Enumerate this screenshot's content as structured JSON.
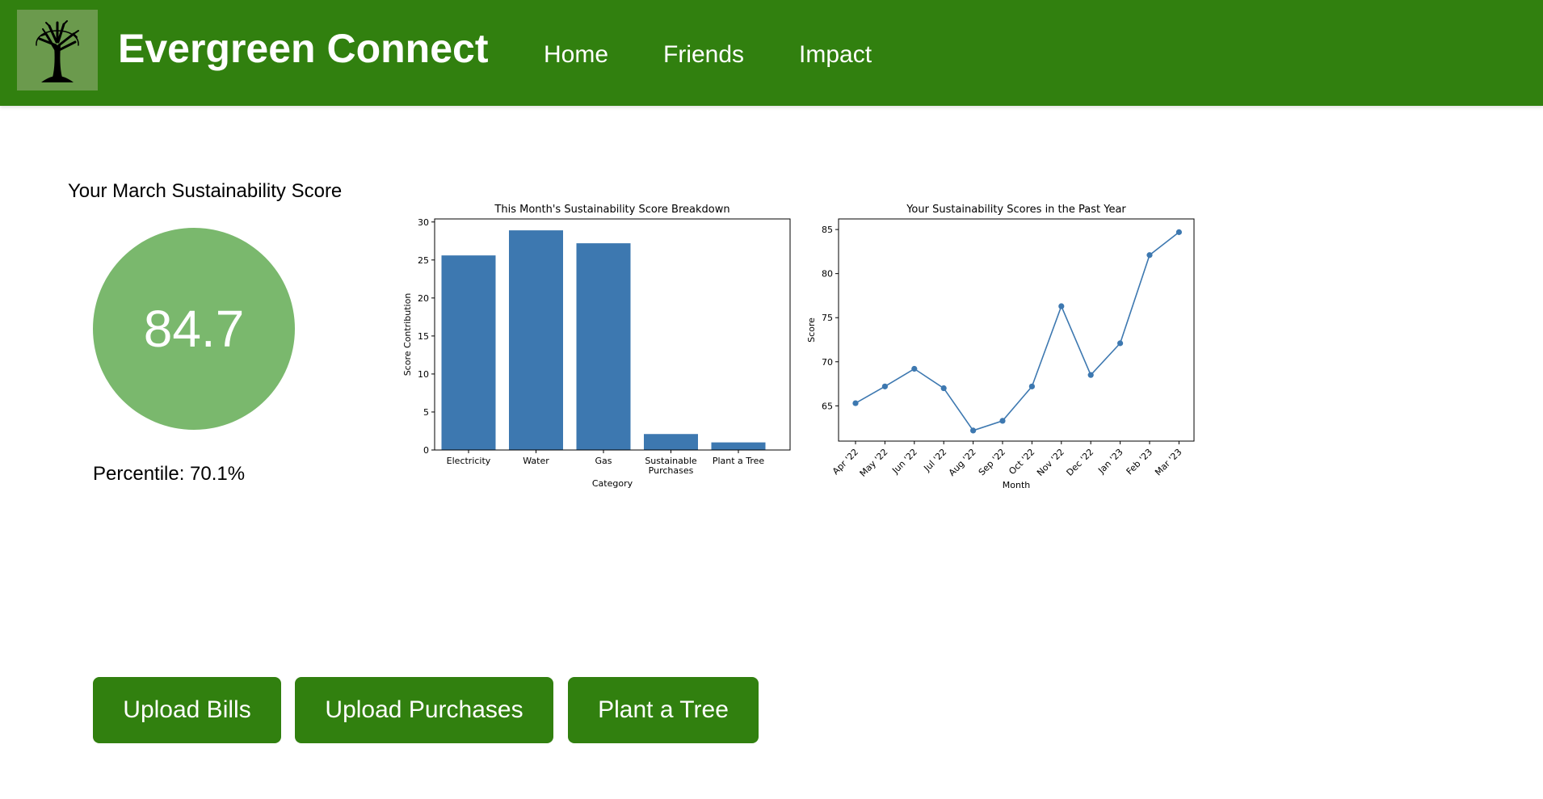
{
  "header": {
    "app_title": "Evergreen Connect",
    "nav": [
      "Home",
      "Friends",
      "Impact"
    ]
  },
  "score": {
    "title": "Your March Sustainability Score",
    "value": "84.7",
    "percentile_label": "Percentile: 70.1%"
  },
  "actions": {
    "upload_bills": "Upload Bills",
    "upload_purchases": "Upload Purchases",
    "plant_tree": "Plant a Tree"
  },
  "colors": {
    "brand_green": "#31800f",
    "score_circle": "#7ab86d",
    "chart_blue": "#3d78b0"
  },
  "chart_data": [
    {
      "type": "bar",
      "title": "This Month's Sustainability Score Breakdown",
      "xlabel": "Category",
      "ylabel": "Score Contribution",
      "categories": [
        "Electricity",
        "Water",
        "Gas",
        "Sustainable Purchases",
        "Plant a Tree"
      ],
      "category_lines": [
        [
          "Electricity"
        ],
        [
          "Water"
        ],
        [
          "Gas"
        ],
        [
          "Sustainable",
          "Purchases"
        ],
        [
          "Plant a Tree"
        ]
      ],
      "values": [
        25.6,
        28.9,
        27.2,
        2.1,
        1.0
      ],
      "ylim": [
        0,
        30.4
      ],
      "yticks": [
        0,
        5,
        10,
        15,
        20,
        25,
        30
      ],
      "grid": false
    },
    {
      "type": "line",
      "title": "Your Sustainability Scores in the Past Year",
      "xlabel": "Month",
      "ylabel": "Score",
      "x": [
        "Apr '22",
        "May '22",
        "Jun '22",
        "Jul '22",
        "Aug '22",
        "Sep '22",
        "Oct '22",
        "Nov '22",
        "Dec '22",
        "Jan '23",
        "Feb '23",
        "Mar '23"
      ],
      "values": [
        65.3,
        67.2,
        69.2,
        67.0,
        62.2,
        63.3,
        67.2,
        76.3,
        68.5,
        72.1,
        82.1,
        84.7
      ],
      "ylim": [
        61.0,
        86.2
      ],
      "yticks": [
        65,
        70,
        75,
        80,
        85
      ],
      "grid": false
    }
  ]
}
